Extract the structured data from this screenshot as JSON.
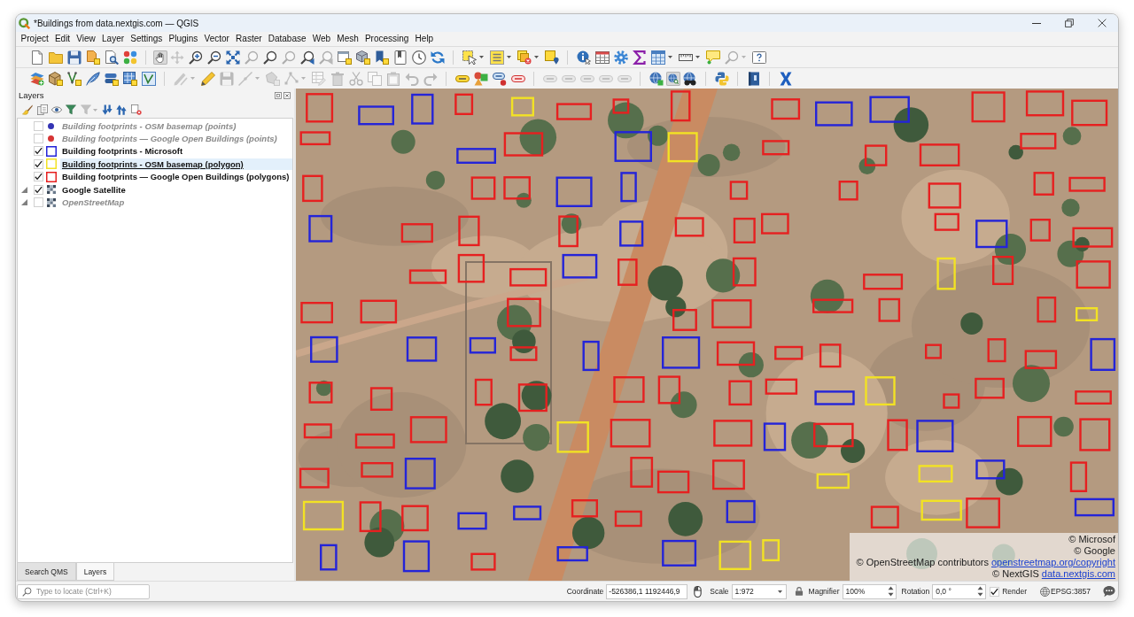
{
  "window": {
    "title": "*Buildings from data.nextgis.com — QGIS"
  },
  "menu": [
    {
      "label": "Project"
    },
    {
      "label": "Edit"
    },
    {
      "label": "View"
    },
    {
      "label": "Layer"
    },
    {
      "label": "Settings"
    },
    {
      "label": "Plugins"
    },
    {
      "label": "Vector"
    },
    {
      "label": "Raster"
    },
    {
      "label": "Database"
    },
    {
      "label": "Web"
    },
    {
      "label": "Mesh"
    },
    {
      "label": "Processing"
    },
    {
      "label": "Help"
    }
  ],
  "toolbars": [
    {
      "groups": [
        {
          "tools": [
            {
              "kind": "page",
              "selected": false,
              "disabled": false,
              "dropdown": false
            },
            {
              "kind": "folder",
              "selected": false,
              "disabled": false,
              "dropdown": false
            },
            {
              "kind": "save",
              "selected": false,
              "disabled": false,
              "dropdown": false
            },
            {
              "kind": "page-badge",
              "selected": false,
              "disabled": false,
              "dropdown": false
            },
            {
              "kind": "page-magnifier",
              "selected": false,
              "disabled": false,
              "dropdown": false
            },
            {
              "kind": "palette",
              "selected": false,
              "disabled": false,
              "dropdown": false
            }
          ]
        },
        {
          "tools": [
            {
              "kind": "hand",
              "selected": true,
              "disabled": false,
              "dropdown": false
            },
            {
              "kind": "move-arrows",
              "selected": false,
              "disabled": true,
              "dropdown": false
            },
            {
              "kind": "zoom-in",
              "selected": false,
              "disabled": false,
              "dropdown": false
            },
            {
              "kind": "zoom-out",
              "selected": false,
              "disabled": false,
              "dropdown": false
            },
            {
              "kind": "expand-arrows",
              "selected": false,
              "disabled": false,
              "dropdown": false
            },
            {
              "kind": "magnifier",
              "selected": false,
              "disabled": true,
              "dropdown": false
            },
            {
              "kind": "magnifier",
              "selected": false,
              "disabled": false,
              "dropdown": false
            },
            {
              "kind": "magnifier",
              "selected": false,
              "disabled": true,
              "dropdown": false
            },
            {
              "kind": "magnifier-arrow",
              "selected": false,
              "disabled": false,
              "dropdown": false
            },
            {
              "kind": "magnifier-arrow",
              "selected": false,
              "disabled": true,
              "dropdown": false
            },
            {
              "kind": "window-badge",
              "selected": false,
              "disabled": false,
              "dropdown": false
            },
            {
              "kind": "cube-badge",
              "selected": false,
              "disabled": false,
              "dropdown": false
            },
            {
              "kind": "bookmark-badge",
              "selected": false,
              "disabled": false,
              "dropdown": false
            },
            {
              "kind": "bookmark",
              "selected": false,
              "disabled": false,
              "dropdown": false
            },
            {
              "kind": "clock",
              "selected": false,
              "disabled": false,
              "dropdown": false
            },
            {
              "kind": "refresh",
              "selected": false,
              "disabled": false,
              "dropdown": false
            }
          ]
        },
        {
          "tools": [
            {
              "kind": "selection-cursor",
              "selected": false,
              "disabled": false,
              "dropdown": true
            },
            {
              "kind": "list",
              "selected": false,
              "disabled": false,
              "dropdown": true
            },
            {
              "kind": "squares-cross",
              "selected": false,
              "disabled": false,
              "dropdown": true
            },
            {
              "kind": "square-pin",
              "selected": false,
              "disabled": false,
              "dropdown": false
            }
          ]
        },
        {
          "tools": [
            {
              "kind": "info-cursor",
              "selected": false,
              "disabled": false,
              "dropdown": false
            },
            {
              "kind": "table",
              "selected": false,
              "disabled": false,
              "dropdown": false
            },
            {
              "kind": "gear",
              "selected": false,
              "disabled": false,
              "dropdown": false
            },
            {
              "kind": "sigma",
              "selected": false,
              "disabled": false,
              "dropdown": false
            },
            {
              "kind": "table-grid",
              "selected": false,
              "disabled": false,
              "dropdown": true
            },
            {
              "kind": "ruler",
              "selected": false,
              "disabled": false,
              "dropdown": true
            },
            {
              "kind": "speech-bubble",
              "selected": false,
              "disabled": false,
              "dropdown": false
            },
            {
              "kind": "magnifier",
              "selected": false,
              "disabled": true,
              "dropdown": true
            },
            {
              "kind": "question-box",
              "selected": false,
              "disabled": false,
              "dropdown": false
            }
          ]
        }
      ]
    },
    {
      "groups": [
        {
          "tools": [
            {
              "kind": "layers-stack",
              "selected": false,
              "disabled": false,
              "dropdown": false
            },
            {
              "kind": "box-badge",
              "selected": false,
              "disabled": false,
              "dropdown": false
            },
            {
              "kind": "vertex-badge",
              "selected": false,
              "disabled": false,
              "dropdown": false
            },
            {
              "kind": "feather",
              "selected": false,
              "disabled": false,
              "dropdown": false
            },
            {
              "kind": "stack-badge",
              "selected": false,
              "disabled": false,
              "dropdown": false
            },
            {
              "kind": "grid-badge",
              "selected": false,
              "disabled": false,
              "dropdown": false
            },
            {
              "kind": "vertex-square",
              "selected": false,
              "disabled": false,
              "dropdown": false
            }
          ]
        },
        {
          "tools": [
            {
              "kind": "pencils",
              "selected": false,
              "disabled": true,
              "dropdown": true
            },
            {
              "kind": "pencil",
              "selected": false,
              "disabled": false,
              "dropdown": false
            },
            {
              "kind": "save",
              "selected": false,
              "disabled": true,
              "dropdown": false
            },
            {
              "kind": "line",
              "selected": false,
              "disabled": true,
              "dropdown": true
            },
            {
              "kind": "shape-badge",
              "selected": false,
              "disabled": true,
              "dropdown": false
            },
            {
              "kind": "nodes",
              "selected": false,
              "disabled": true,
              "dropdown": true
            },
            {
              "kind": "table-pencil",
              "selected": false,
              "disabled": true,
              "dropdown": false
            },
            {
              "kind": "trash",
              "selected": false,
              "disabled": true,
              "dropdown": false
            },
            {
              "kind": "scissors",
              "selected": false,
              "disabled": true,
              "dropdown": false
            },
            {
              "kind": "copy",
              "selected": false,
              "disabled": true,
              "dropdown": false
            },
            {
              "kind": "clipboard",
              "selected": false,
              "disabled": true,
              "dropdown": false
            },
            {
              "kind": "undo",
              "selected": false,
              "disabled": true,
              "dropdown": false
            },
            {
              "kind": "redo",
              "selected": false,
              "disabled": true,
              "dropdown": false
            }
          ]
        },
        {
          "tools": [
            {
              "kind": "tag",
              "selected": false,
              "disabled": false,
              "dropdown": false
            },
            {
              "kind": "shapes",
              "selected": false,
              "disabled": false,
              "dropdown": false
            },
            {
              "kind": "tag-pin",
              "selected": false,
              "disabled": false,
              "dropdown": false
            },
            {
              "kind": "tag-red",
              "selected": false,
              "disabled": false,
              "dropdown": false
            }
          ]
        },
        {
          "tools": [
            {
              "kind": "tag",
              "selected": false,
              "disabled": true,
              "dropdown": false
            },
            {
              "kind": "tag",
              "selected": false,
              "disabled": true,
              "dropdown": false
            },
            {
              "kind": "tag",
              "selected": false,
              "disabled": true,
              "dropdown": false
            },
            {
              "kind": "tag",
              "selected": false,
              "disabled": true,
              "dropdown": false
            },
            {
              "kind": "tag",
              "selected": false,
              "disabled": true,
              "dropdown": false
            }
          ]
        },
        {
          "tools": [
            {
              "kind": "globe-badge",
              "selected": false,
              "disabled": false,
              "dropdown": false
            },
            {
              "kind": "globe-magnifier",
              "selected": true,
              "disabled": false,
              "dropdown": false
            },
            {
              "kind": "globe-binoculars",
              "selected": false,
              "disabled": false,
              "dropdown": false
            }
          ]
        },
        {
          "tools": [
            {
              "kind": "interlocked-shapes",
              "selected": false,
              "disabled": false,
              "dropdown": false
            }
          ]
        },
        {
          "tools": [
            {
              "kind": "book",
              "selected": false,
              "disabled": false,
              "dropdown": false
            }
          ]
        },
        {
          "tools": [
            {
              "kind": "cross",
              "selected": false,
              "disabled": false,
              "dropdown": false
            }
          ]
        }
      ]
    }
  ],
  "layers_panel": {
    "title": "Layers",
    "tools": [
      {
        "kind": "brush",
        "disabled": false,
        "dropdown": false
      },
      {
        "kind": "pages",
        "disabled": false,
        "dropdown": false
      },
      {
        "kind": "eye",
        "disabled": false,
        "dropdown": false
      },
      {
        "kind": "funnel",
        "disabled": false,
        "dropdown": false
      },
      {
        "kind": "funnel",
        "disabled": true,
        "dropdown": true
      },
      {
        "kind": "arrows-down",
        "disabled": false,
        "dropdown": false
      },
      {
        "kind": "arrows-up",
        "disabled": false,
        "dropdown": false
      },
      {
        "kind": "page-cross",
        "disabled": false,
        "dropdown": false
      }
    ],
    "layers": [
      {
        "name": "Building footprints - OSM basemap (points)",
        "kind": "points",
        "checked": false,
        "selected": false,
        "color": "#3434b4"
      },
      {
        "name": "Building footprints — Google Open Buildings (points)",
        "kind": "points",
        "checked": false,
        "selected": false,
        "color": "#d63434"
      },
      {
        "name": "Building footprints - Microsoft",
        "kind": "polygons",
        "checked": true,
        "selected": false,
        "color": "#2424d8"
      },
      {
        "name": "Building footprints - OSM basemap (polygon)",
        "kind": "polygons",
        "checked": true,
        "selected": true,
        "color": "#f2e224"
      },
      {
        "name": "Building footprints — Google Open Buildings (polygons)",
        "kind": "polygons",
        "checked": true,
        "selected": false,
        "color": "#e62020"
      },
      {
        "name": "Google Satellite",
        "kind": "imagery",
        "checked": true,
        "selected": false
      },
      {
        "name": "OpenStreetMap",
        "kind": "streetmap",
        "checked": false,
        "selected": false
      }
    ]
  },
  "dock_tabs": [
    {
      "label": "Search QMS",
      "selected": false
    },
    {
      "label": "Layers",
      "selected": true
    }
  ],
  "map": {
    "attribution": [
      {
        "text": "© Microsof"
      },
      {
        "text": "© Google"
      },
      {
        "text": "© OpenStreetMap contributors",
        "link": "openstreetmap.org/copyright"
      },
      {
        "text": "© NextGIS",
        "link": "data.nextgis.com"
      }
    ]
  },
  "status_bar": {
    "locator": {
      "placeholder": "Type to locate (Ctrl+K)"
    },
    "coordinate": {
      "label": "Coordinate",
      "value": "-526386,1 1192446,9"
    },
    "scale": {
      "label": "Scale",
      "value": "1:972"
    },
    "magnifier": {
      "label": "Magnifier",
      "value": "100%"
    },
    "rotation": {
      "label": "Rotation",
      "value": "0,0 °"
    },
    "render": {
      "label": "Render",
      "checked": true
    },
    "crs": {
      "label": "EPSG:3857"
    }
  }
}
